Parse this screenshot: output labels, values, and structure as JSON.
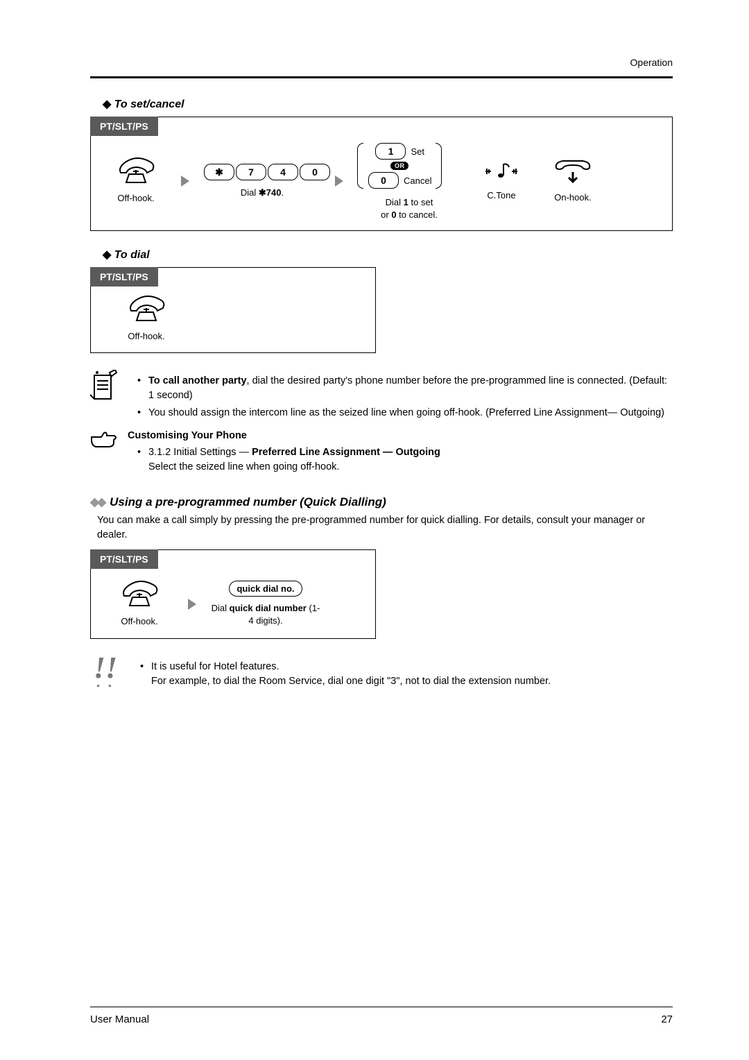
{
  "header": {
    "section": "Operation"
  },
  "proc1": {
    "title": "To set/cancel",
    "tab": "PT/SLT/PS",
    "step_offhook": "Off-hook.",
    "dial_keys": [
      "✱",
      "7",
      "4",
      "0"
    ],
    "dial_caption_pre": "Dial ",
    "dial_code": "✱740",
    "dial_caption_post": ".",
    "choice": {
      "set_key": "1",
      "set_label": "Set",
      "or": "OR",
      "cancel_key": "0",
      "cancel_label": "Cancel",
      "caption_line1_a": "Dial ",
      "caption_line1_b": "1",
      "caption_line1_c": " to set",
      "caption_line2_a": "or ",
      "caption_line2_b": "0",
      "caption_line2_c": " to cancel."
    },
    "ctone": "C.Tone",
    "onhook": "On-hook."
  },
  "proc2": {
    "title": "To dial",
    "tab": "PT/SLT/PS",
    "step_offhook": "Off-hook."
  },
  "notes": {
    "b1_lead": "To call another party",
    "b1_rest": ", dial the desired party's phone number before the pre-programmed line is connected. (Default: 1 second)",
    "b2": "You should assign the intercom line as the seized line when going off-hook. (Preferred Line Assignment— Outgoing)"
  },
  "custom": {
    "heading": "Customising Your Phone",
    "ref": "3.1.2    Initial Settings — ",
    "ref_bold": "Preferred Line Assignment — Outgoing",
    "line2": "Select the seized line when going off-hook."
  },
  "section_quick": {
    "heading": "Using a pre-programmed number (Quick Dialling)",
    "para": "You can make a call simply by pressing the pre-programmed number for quick dialling. For details, consult your manager or dealer."
  },
  "proc3": {
    "tab": "PT/SLT/PS",
    "step_offhook": "Off-hook.",
    "pill": "quick dial no.",
    "cap_a": "Dial ",
    "cap_b": "quick dial number",
    "cap_c": " (1-4 digits)."
  },
  "tip": {
    "line1": "It is useful for Hotel features.",
    "line2": "For example, to dial the Room Service, dial one digit \"3\", not to dial the extension number."
  },
  "footer": {
    "left": "User Manual",
    "page": "27"
  }
}
